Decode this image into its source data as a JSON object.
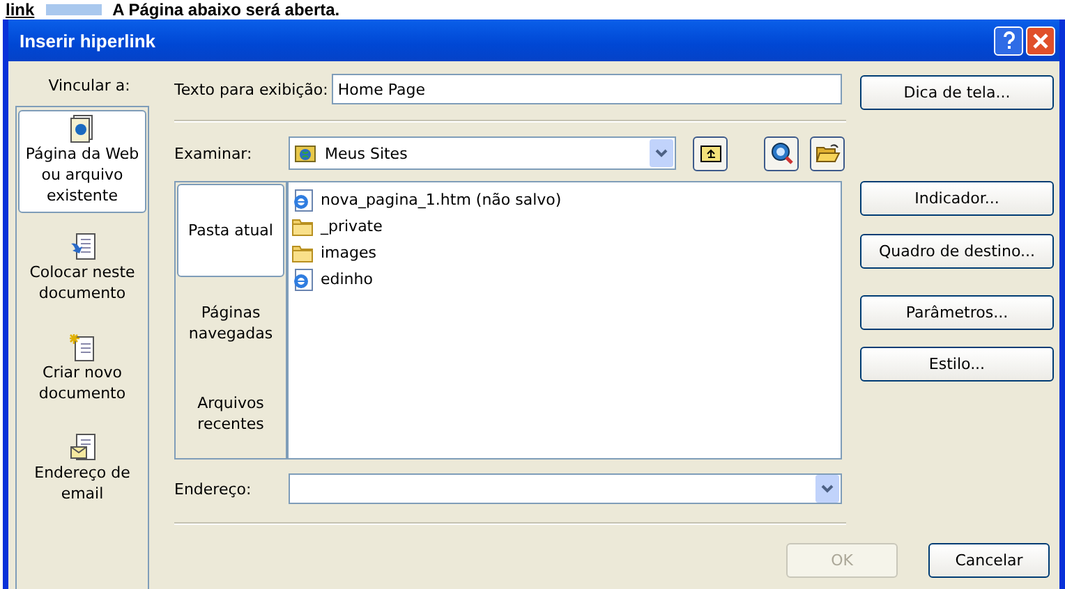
{
  "page_header": {
    "link": "link",
    "caption": "A Página abaixo será aberta."
  },
  "window": {
    "title": "Inserir hiperlink"
  },
  "link_to": {
    "label": "Vincular a:",
    "items": [
      {
        "kind": "web",
        "label": "Página da Web ou arquivo existente",
        "selected": true
      },
      {
        "kind": "place",
        "label": "Colocar neste documento",
        "selected": false
      },
      {
        "kind": "new",
        "label": "Criar novo documento",
        "selected": false
      },
      {
        "kind": "email",
        "label": "Endereço de email",
        "selected": false
      }
    ]
  },
  "display_text": {
    "label": "Texto para exibição:",
    "value": "Home Page"
  },
  "look_in": {
    "label": "Examinar:",
    "value": "Meus Sites"
  },
  "places": [
    {
      "label": "Pasta atual",
      "selected": true
    },
    {
      "label": "Páginas navegadas",
      "selected": false
    },
    {
      "label": "Arquivos recentes",
      "selected": false
    }
  ],
  "files": [
    {
      "kind": "web",
      "name": "nova_pagina_1.htm (não salvo)"
    },
    {
      "kind": "folder",
      "name": "_private"
    },
    {
      "kind": "folder",
      "name": "images"
    },
    {
      "kind": "web",
      "name": "edinho"
    }
  ],
  "address": {
    "label": "Endereço:"
  },
  "side_buttons": [
    "Dica de tela...",
    "Indicador...",
    "Quadro de destino...",
    "Parâmetros...",
    "Estilo..."
  ],
  "ok": {
    "label": "OK",
    "disabled": true
  },
  "cancel": {
    "label": "Cancelar",
    "disabled": false
  }
}
